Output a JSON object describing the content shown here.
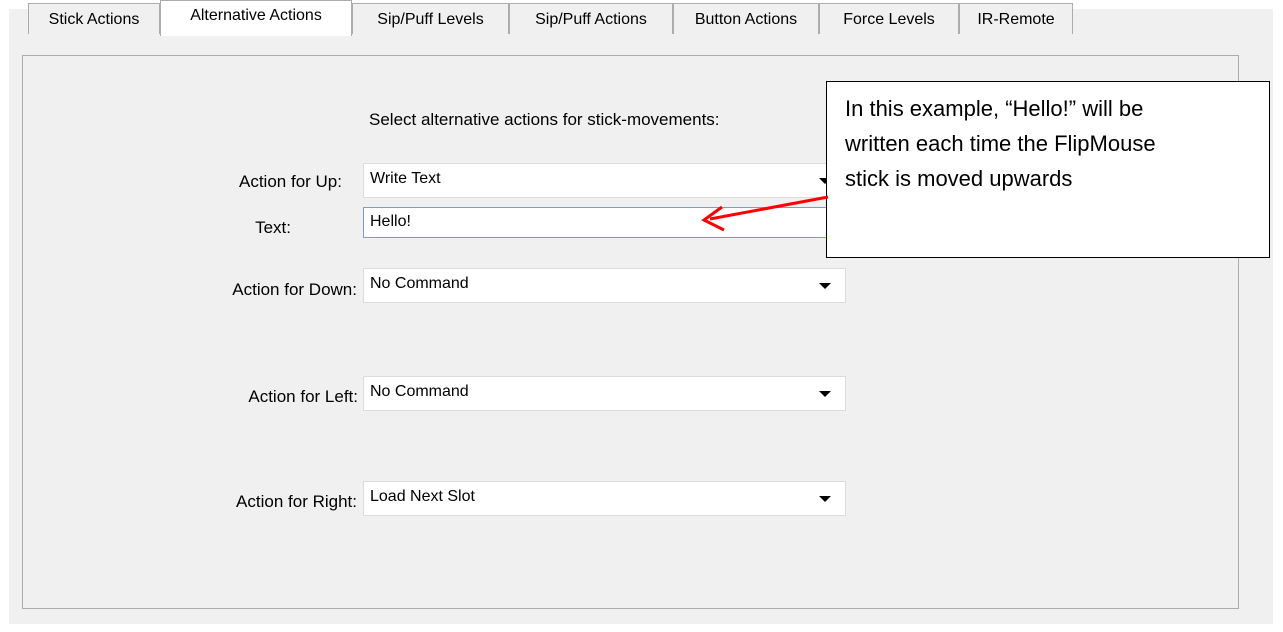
{
  "tabs": [
    {
      "label": "Stick Actions",
      "active": false
    },
    {
      "label": "Alternative Actions",
      "active": true
    },
    {
      "label": "Sip/Puff Levels",
      "active": false
    },
    {
      "label": "Sip/Puff Actions",
      "active": false
    },
    {
      "label": "Button Actions",
      "active": false
    },
    {
      "label": "Force Levels",
      "active": false
    },
    {
      "label": "IR-Remote",
      "active": false
    }
  ],
  "panel": {
    "heading": "Select alternative actions for stick-movements:",
    "up": {
      "label": "Action for Up:",
      "value": "Write Text"
    },
    "text": {
      "label": "Text:",
      "value": "Hello!"
    },
    "down": {
      "label": "Action for Down:",
      "value": "No Command"
    },
    "left": {
      "label": "Action for Left:",
      "value": "No Command"
    },
    "right": {
      "label": "Action for Right:",
      "value": "Load Next Slot"
    }
  },
  "callout": {
    "lines": [
      "In this example, “Hello!” will be",
      "written each time the FlipMouse",
      "stick is moved upwards"
    ],
    "arrow_color": "#ff0000"
  }
}
